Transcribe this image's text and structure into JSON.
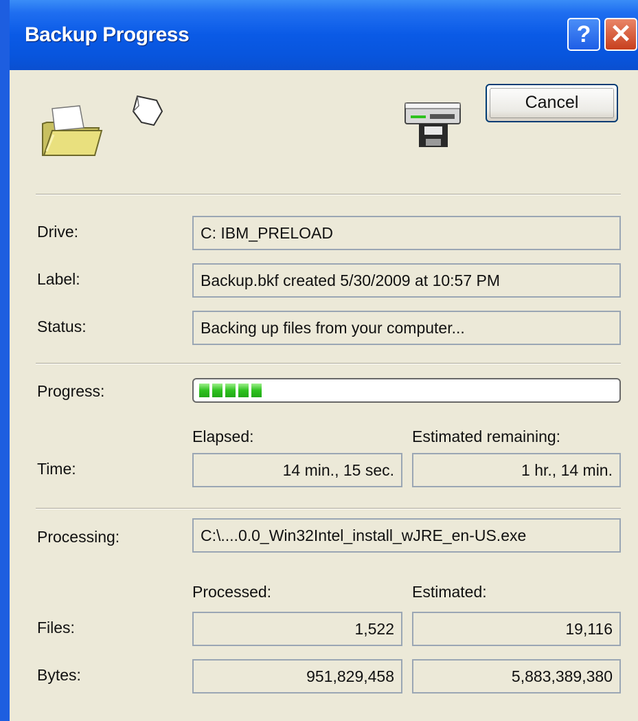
{
  "window": {
    "title": "Backup Progress",
    "help_glyph": "?",
    "close_glyph": "✕"
  },
  "icons": [
    "folder-icon",
    "flying-paper-icon",
    "tape-drive-icon"
  ],
  "cancel_label": "Cancel",
  "drive": {
    "label": "Drive:",
    "value": "C: IBM_PRELOAD"
  },
  "media_label": {
    "label": "Label:",
    "value": "Backup.bkf created 5/30/2009 at 10:57 PM"
  },
  "status": {
    "label": "Status:",
    "value": "Backing up files from your computer..."
  },
  "progress": {
    "label": "Progress:",
    "fraction": 0.18,
    "color": "#2ec21f"
  },
  "time": {
    "label": "Time:",
    "elapsed_header": "Elapsed:",
    "remaining_header": "Estimated remaining:",
    "elapsed": "14 min., 15 sec.",
    "remaining": "1 hr., 14 min."
  },
  "processing": {
    "label": "Processing:",
    "value": "C:\\....0.0_Win32Intel_install_wJRE_en-US.exe"
  },
  "counts": {
    "processed_header": "Processed:",
    "estimated_header": "Estimated:",
    "files_label": "Files:",
    "files_processed": "1,522",
    "files_estimated": "19,116",
    "bytes_label": "Bytes:",
    "bytes_processed": "951,829,458",
    "bytes_estimated": "5,883,389,380"
  }
}
